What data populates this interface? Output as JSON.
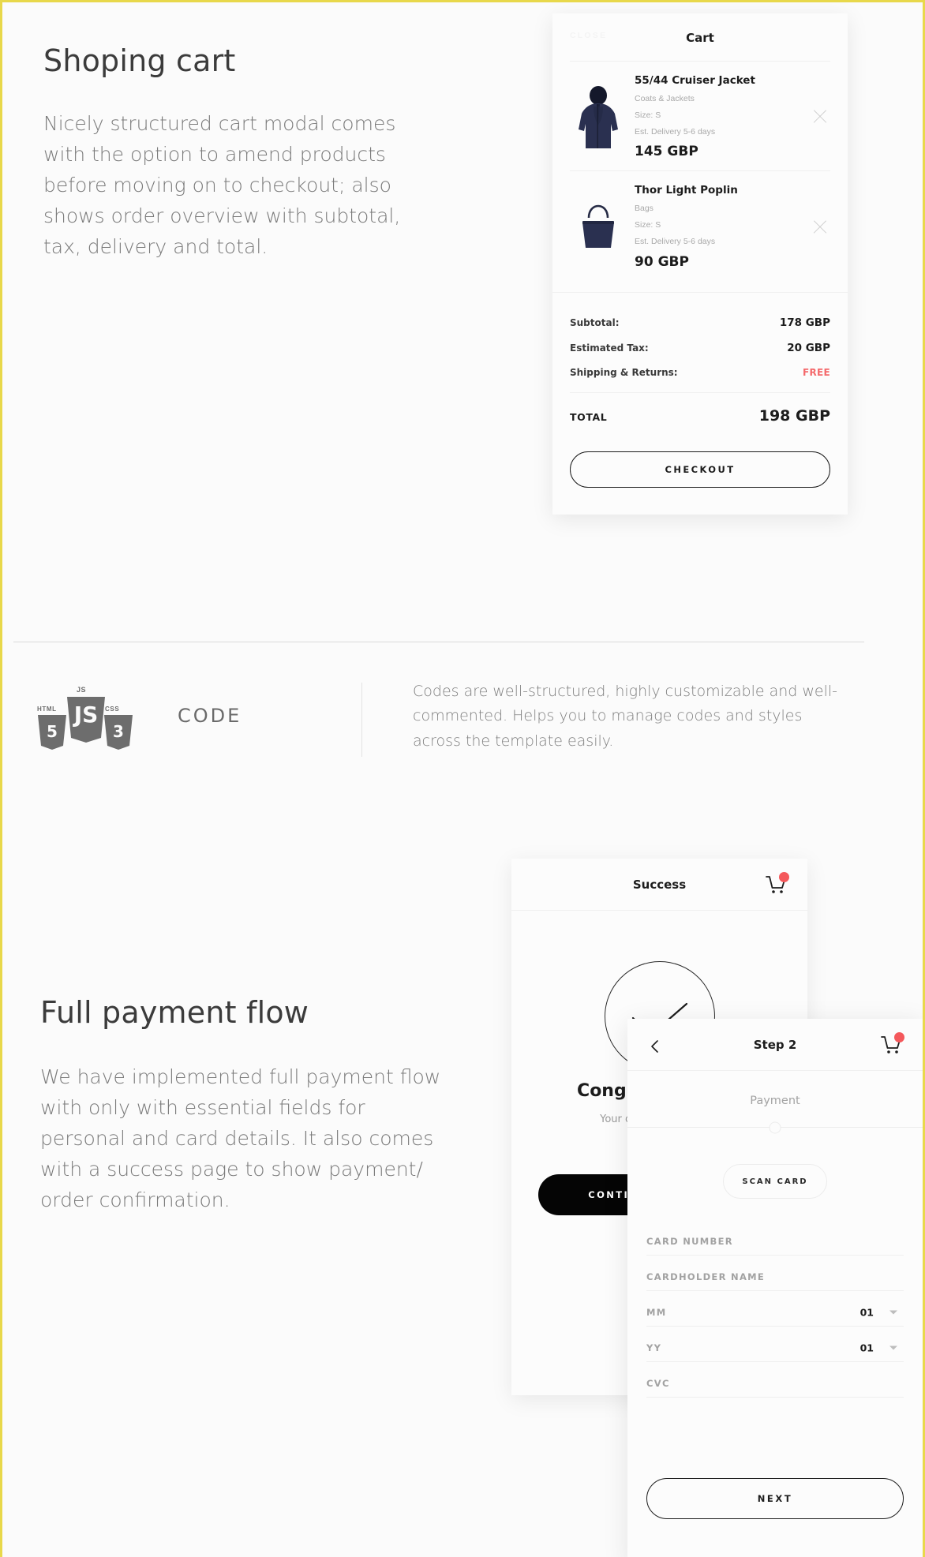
{
  "section_cart": {
    "headline": "Shoping cart",
    "body": "Nicely structured cart modal comes with the option to amend products before moving on to checkout; also shows order overview with subtotal, tax, delivery and total.",
    "modal": {
      "close_label": "CLOSE",
      "title": "Cart",
      "items": [
        {
          "name": "55/44 Cruiser Jacket",
          "category": "Coats & Jackets",
          "size": "Size: S",
          "delivery": "Est. Delivery 5-6 days",
          "price": "145 GBP",
          "thumb": "navy-jacket-image"
        },
        {
          "name": "Thor Light Poplin",
          "category": "Bags",
          "size": "Size: S",
          "delivery": "Est. Delivery 5-6 days",
          "price": "90 GBP",
          "thumb": "navy-tote-bag-image"
        }
      ],
      "summary": [
        {
          "label": "Subtotal:",
          "value": "178 GBP",
          "free": false
        },
        {
          "label": "Estimated Tax:",
          "value": "20 GBP",
          "free": false
        },
        {
          "label": "Shipping & Returns:",
          "value": "FREE",
          "free": true
        }
      ],
      "total_label": "TOTAL",
      "total_value": "198 GBP",
      "checkout_label": "CHECKOUT",
      "free_color": "#f4696b"
    }
  },
  "section_code": {
    "logos": [
      "HTML5",
      "JS",
      "CSS3"
    ],
    "logo_labels": {
      "html": "HTML",
      "html_num": "5",
      "js": "JS",
      "js_num": "JS",
      "css": "CSS",
      "css_num": "3"
    },
    "word": "CODE",
    "text": "Codes are well-structured, highly customizable and well-commented. Helps you to manage codes and styles across the template easily."
  },
  "section_payment": {
    "headline": "Full payment flow",
    "body": "We have implemented full payment flow with only with essential fields for personal and card details. It also comes with a success page to show payment/ order confirmation.",
    "success_modal": {
      "title": "Success",
      "cart_icon": "shopping-cart-icon",
      "badge_color": "#f4585b",
      "heading": "Congratulations!",
      "subtext": "Your order is confirmed",
      "button_label": "CONTINUE SHOPPING"
    },
    "step_modal": {
      "back_icon": "chevron-left-icon",
      "title": "Step 2",
      "cart_icon": "shopping-cart-icon",
      "badge_color": "#f4585b",
      "progress_label": "Payment",
      "scan_label": "SCAN CARD",
      "fields": [
        {
          "label": "CARD NUMBER",
          "value": "",
          "type": "text"
        },
        {
          "label": "CARDHOLDER NAME",
          "value": "",
          "type": "text"
        },
        {
          "label": "MM",
          "value": "01",
          "type": "select"
        },
        {
          "label": "YY",
          "value": "01",
          "type": "select"
        },
        {
          "label": "CVC",
          "value": "",
          "type": "text"
        }
      ],
      "next_label": "NEXT"
    }
  }
}
